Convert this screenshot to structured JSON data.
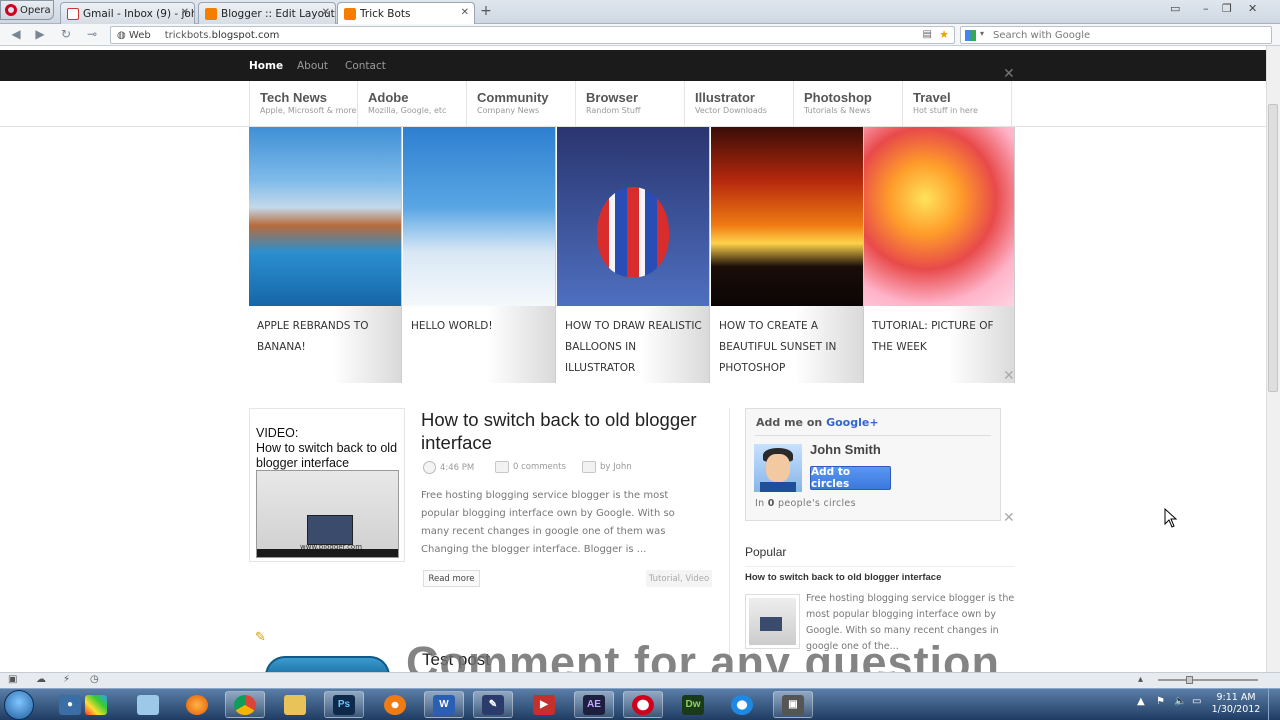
{
  "browser": {
    "menu_label": "Opera",
    "tabs": [
      {
        "label": "Gmail - Inbox (9) - john..."
      },
      {
        "label": "Blogger :: Edit Layout"
      },
      {
        "label": "Trick Bots"
      }
    ],
    "address": {
      "web_label": "Web",
      "domain_prefix": "trickbots.",
      "domain_main": "blogspot.com"
    },
    "search_placeholder": "Search with Google"
  },
  "site": {
    "top_nav": [
      "Home",
      "About",
      "Contact"
    ],
    "categories": [
      {
        "title": "Tech News",
        "subtitle": "Apple, Microsoft & more"
      },
      {
        "title": "Adobe",
        "subtitle": "Mozilla, Google, etc"
      },
      {
        "title": "Community",
        "subtitle": "Company News"
      },
      {
        "title": "Browser",
        "subtitle": "Random Stuff"
      },
      {
        "title": "Illustrator",
        "subtitle": "Vector Downloads"
      },
      {
        "title": "Photoshop",
        "subtitle": "Tutorials & News"
      },
      {
        "title": "Travel",
        "subtitle": "Hot stuff in here"
      }
    ],
    "slides": [
      {
        "caption": "Apple rebrands to Banana!"
      },
      {
        "caption": "Hello World!"
      },
      {
        "caption": "How to draw realistic balloons in Illustrator"
      },
      {
        "caption": "How to create a beautiful sunset in Photoshop"
      },
      {
        "caption": "Tutorial: Picture of the week"
      }
    ],
    "post": {
      "thumb_label_1": "VIDEO:",
      "thumb_label_2": "How to switch back to old blogger interface",
      "thumb_caption": "www.blogger.com",
      "title": "How to switch back to old blogger interface",
      "time": "4:46 PM",
      "comments": "0 comments",
      "author": "by John",
      "excerpt": "Free hosting blogging service blogger is the most popular blogging interface own by Google. With so many recent changes in google one of them was Changing the blogger interface. Blogger is ...",
      "read_more": "Read more",
      "tags": "Tutorial, Video"
    },
    "next_post_title": "Test post",
    "sidebar": {
      "add_me_prefix": "Add me on",
      "add_me_brand": "Google+",
      "user_name": "John Smith",
      "add_button": "Add to circles",
      "circles_prefix": "In",
      "circles_count": "0",
      "circles_suffix": "people's circles",
      "popular_heading": "Popular",
      "popular_title": "How to switch back to old blogger interface",
      "popular_excerpt": "Free hosting blogging service blogger is the most popular blogging interface own by Google. With so many recent changes in google one of the..."
    }
  },
  "overlay_text": "Comment for any question",
  "taskbar": {
    "time": "9:11 AM",
    "date": "1/30/2012",
    "apps": [
      "Photoshop",
      "Word",
      "After Effects",
      "Dreamweaver"
    ],
    "app_labels": {
      "ps": "Ps",
      "word": "W",
      "ae": "AE",
      "dw": "Dw"
    }
  },
  "colors": {
    "accent": "#3b78dc",
    "nav_bg": "#1b1b1b",
    "taskbar": "#1f3d63"
  }
}
